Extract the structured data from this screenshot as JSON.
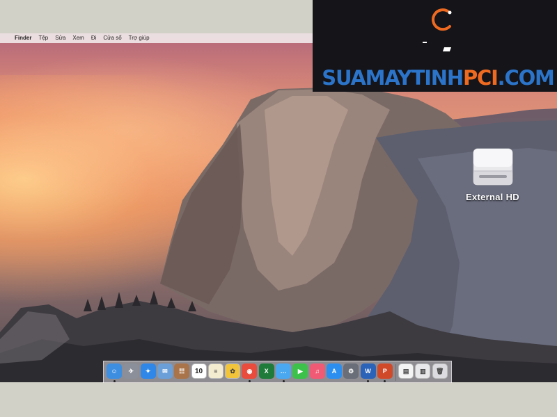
{
  "menubar": {
    "apple_symbol": "",
    "app_name": "Finder",
    "items": [
      "Tệp",
      "Sửa",
      "Xem",
      "Đi",
      "Cửa sổ",
      "Trợ giúp"
    ]
  },
  "desktop": {
    "drive_label": "External HD"
  },
  "dock": {
    "items": [
      {
        "name": "finder-icon",
        "color": "#3d8ee0",
        "glyph": "☺",
        "running": true
      },
      {
        "name": "launchpad-icon",
        "color": "#8a8f99",
        "glyph": "✈",
        "running": false
      },
      {
        "name": "safari-icon",
        "color": "#2f87e8",
        "glyph": "✦",
        "running": false
      },
      {
        "name": "mail-icon",
        "color": "#6b9fd8",
        "glyph": "✉",
        "running": false
      },
      {
        "name": "contacts-icon",
        "color": "#a9744a",
        "glyph": "☷",
        "running": false
      },
      {
        "name": "calendar-icon",
        "color": "#ffffff",
        "glyph": "10",
        "running": false
      },
      {
        "name": "notes-icon",
        "color": "#f4ecd0",
        "glyph": "≡",
        "running": false
      },
      {
        "name": "photos-icon",
        "color": "#f1c43a",
        "glyph": "✿",
        "running": false
      },
      {
        "name": "chrome-icon",
        "color": "#e94b3c",
        "glyph": "◉",
        "running": true
      },
      {
        "name": "excel-icon",
        "color": "#1e7b3a",
        "glyph": "X",
        "running": false
      },
      {
        "name": "messages-icon",
        "color": "#4aa8f0",
        "glyph": "…",
        "running": true
      },
      {
        "name": "facetime-icon",
        "color": "#3cc24a",
        "glyph": "▶",
        "running": false
      },
      {
        "name": "music-icon",
        "color": "#f05a74",
        "glyph": "♫",
        "running": false
      },
      {
        "name": "app-store-icon",
        "color": "#2c8ff0",
        "glyph": "A",
        "running": false
      },
      {
        "name": "system-preferences-icon",
        "color": "#6a6e78",
        "glyph": "⚙",
        "running": false
      },
      {
        "name": "word-icon",
        "color": "#2b63b8",
        "glyph": "W",
        "running": true
      },
      {
        "name": "powerpoint-icon",
        "color": "#d04a2a",
        "glyph": "P",
        "running": true
      },
      {
        "name": "document-icon",
        "color": "#f4f4f4",
        "glyph": "▤",
        "running": false
      },
      {
        "name": "downloads-stack-icon",
        "color": "#e8e8ea",
        "glyph": "▥",
        "running": false
      },
      {
        "name": "trash-icon",
        "color": "#dcdce0",
        "glyph": "🗑",
        "running": false
      }
    ]
  },
  "watermark": {
    "text_blue_1": "SUAMAYTINH",
    "text_orange": "PCI",
    "text_blue_2": ".COM",
    "logo_color": "#ef6a21"
  }
}
